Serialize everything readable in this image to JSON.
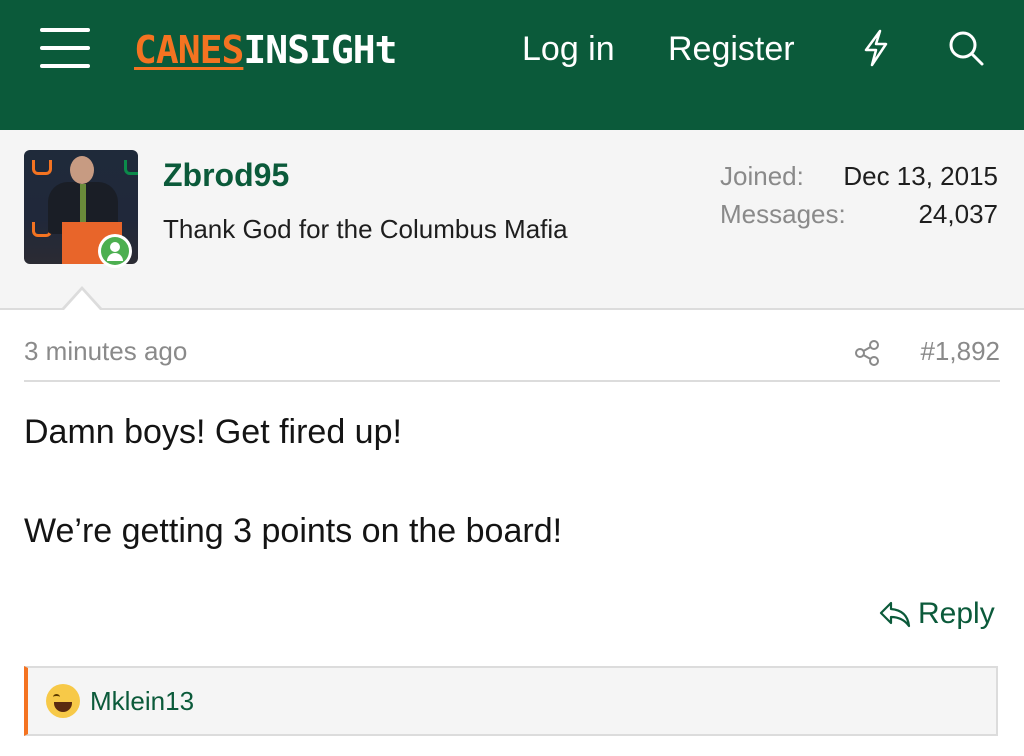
{
  "header": {
    "logo_part1": "CANES",
    "logo_part2": "INSIGHt",
    "login_label": "Log in",
    "register_label": "Register",
    "bolt_icon": "bolt-icon",
    "search_icon": "search-icon",
    "menu_icon": "hamburger-menu-icon"
  },
  "user": {
    "name": "Zbrod95",
    "title": "Thank God for the Columbus Mafia",
    "joined_label": "Joined:",
    "joined_value": "Dec 13, 2015",
    "messages_label": "Messages:",
    "messages_value": "24,037",
    "online": true
  },
  "post": {
    "time": "3 minutes ago",
    "number": "#1,892",
    "line1": "Damn boys! Get fired up!",
    "line2": "We’re getting 3 points on the board!",
    "reply_label": "Reply"
  },
  "reactions": {
    "emoji": "laughing-tears-emoji",
    "user": "Mklein13"
  },
  "colors": {
    "brand_green": "#0b5a3a",
    "brand_orange": "#f47321",
    "online_green": "#4caf50"
  }
}
